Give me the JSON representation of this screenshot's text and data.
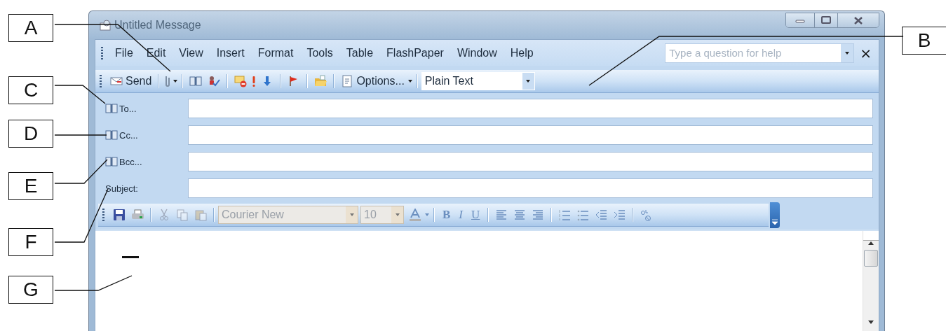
{
  "window": {
    "title": "Untitled Message"
  },
  "menu": {
    "items": [
      {
        "label": "File"
      },
      {
        "label": "Edit"
      },
      {
        "label": "View"
      },
      {
        "label": "Insert"
      },
      {
        "label": "Format"
      },
      {
        "label": "Tools"
      },
      {
        "label": "Table"
      },
      {
        "label": "FlashPaper"
      },
      {
        "label": "Window"
      },
      {
        "label": "Help"
      }
    ],
    "help": {
      "placeholder": "Type a question for help"
    },
    "close": "×"
  },
  "toolbar": {
    "send": {
      "label": "Send"
    },
    "options": {
      "label": "Options..."
    },
    "message_format": {
      "value": "Plain Text"
    }
  },
  "fields": [
    {
      "label": "To...",
      "kind": "address"
    },
    {
      "label": "Cc...",
      "kind": "address"
    },
    {
      "label": "Bcc...",
      "kind": "address"
    },
    {
      "label": "Subject:",
      "kind": "plain"
    }
  ],
  "format_toolbar": {
    "clipboard_disabled": true,
    "font": {
      "value": "Courier New",
      "disabled": true
    },
    "size": {
      "value": "10",
      "disabled": true
    },
    "bold": "B",
    "italic": "I",
    "underline": "U"
  },
  "callouts": [
    {
      "letter": "A"
    },
    {
      "letter": "B"
    },
    {
      "letter": "C"
    },
    {
      "letter": "D"
    },
    {
      "letter": "E"
    },
    {
      "letter": "F"
    },
    {
      "letter": "G"
    }
  ]
}
